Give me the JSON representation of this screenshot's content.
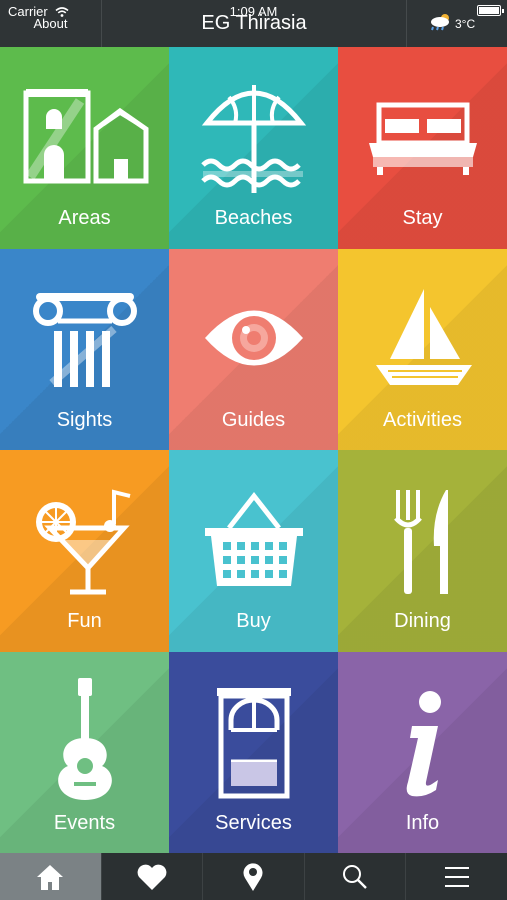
{
  "status": {
    "carrier": "Carrier",
    "time": "1:09 AM"
  },
  "nav": {
    "about_label": "About",
    "title": "EG Thirasia",
    "weather_icon": "cloud-rain-sun-icon",
    "temperature": "3°C"
  },
  "tiles": [
    {
      "label": "Areas",
      "color": "#5dbb4c",
      "icon": "houses-icon"
    },
    {
      "label": "Beaches",
      "color": "#2fb8b8",
      "icon": "beach-umbrella-icon"
    },
    {
      "label": "Stay",
      "color": "#e84e40",
      "icon": "bed-icon"
    },
    {
      "label": "Sights",
      "color": "#3a86c9",
      "icon": "column-icon"
    },
    {
      "label": "Guides",
      "color": "#ef7d70",
      "icon": "eye-icon"
    },
    {
      "label": "Activities",
      "color": "#f4c52e",
      "icon": "sailboat-icon"
    },
    {
      "label": "Fun",
      "color": "#f79b22",
      "icon": "cocktail-icon"
    },
    {
      "label": "Buy",
      "color": "#49c2cf",
      "icon": "basket-icon"
    },
    {
      "label": "Dining",
      "color": "#a5b23a",
      "icon": "fork-knife-icon"
    },
    {
      "label": "Events",
      "color": "#6fbf82",
      "icon": "guitar-icon"
    },
    {
      "label": "Services",
      "color": "#3a4c9c",
      "icon": "window-icon"
    },
    {
      "label": "Info",
      "color": "#8a64a8",
      "icon": "info-icon"
    }
  ],
  "tabbar": [
    {
      "icon": "home-icon"
    },
    {
      "icon": "heart-icon"
    },
    {
      "icon": "map-pin-icon"
    },
    {
      "icon": "search-icon"
    },
    {
      "icon": "menu-icon"
    }
  ]
}
